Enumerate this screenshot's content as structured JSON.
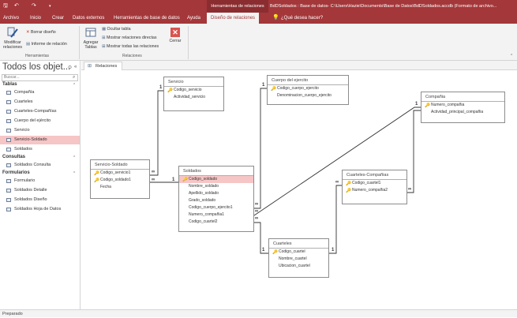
{
  "titlebar": {
    "context_tab": "Herramientas de relaciones",
    "title": "BdDSoldados : Base de datos- C:\\Users\\Hazie\\Documents\\Base de Datos\\BdDSoldados.accdb (Formato de archivo..."
  },
  "tabs": [
    "Archivo",
    "Inicio",
    "Crear",
    "Datos externos",
    "Herramientas de base de datos",
    "Ayuda",
    "Diseño de relaciones",
    "¿Qué desea hacer?"
  ],
  "ribbon": {
    "modify_label": "Modificar relaciones",
    "clear_layout": "Borrar diseño",
    "relation_report": "Informe de relación",
    "tools_group": "Herramientas",
    "add_tables": "Agregar Tablas",
    "hide_table": "Ocultar tabla",
    "direct_relations": "Mostrar relaciones directas",
    "all_relations": "Mostrar todas las relaciones",
    "relations_group": "Relaciones",
    "close": "Cerrar"
  },
  "nav": {
    "header": "Todos los objet...",
    "search_placeholder": "Buscar...",
    "sections": [
      {
        "label": "Tablas",
        "items": [
          "Compañía",
          "Cuarteles",
          "Cuarteles-Compañías",
          "Cuerpo del ejército",
          "Servicio",
          "Servicio-Soldado",
          "Soldados"
        ]
      },
      {
        "label": "Consultas",
        "items": [
          "Soldados Consulta"
        ]
      },
      {
        "label": "Formularios",
        "items": [
          "Formulario",
          "Soldados Detalle",
          "Soldados Diseño",
          "Soldados Hoja de Datos"
        ]
      }
    ],
    "selected": "Servicio-Soldado"
  },
  "doc_tab": "Relaciones",
  "tables": {
    "servicio": {
      "title": "Servicio",
      "fields": [
        "Codigo_servicio",
        "Actividad_servicio"
      ],
      "pk": [
        0
      ]
    },
    "cuerpo": {
      "title": "Cuerpo del ejercito",
      "fields": [
        "Codigo_cuerpo_ejercito",
        "Denominacion_cuerpo_ejercito"
      ],
      "pk": [
        0
      ]
    },
    "compania": {
      "title": "Compañia",
      "fields": [
        "Numero_compañia",
        "Actividad_principal_compañia"
      ],
      "pk": [
        0
      ]
    },
    "servsold": {
      "title": "Servicio-Soldado",
      "fields": [
        "Codigo_servicio1",
        "Codigo_soldado1",
        "Fecha"
      ],
      "pk": [
        0,
        1
      ]
    },
    "soldados": {
      "title": "Soldados",
      "fields": [
        "Codigo_soldado",
        "Nombre_soldado",
        "Apellido_soldado",
        "Grado_soldado",
        "Codigo_cuerpo_ejercito1",
        "Numero_compañia1",
        "Codigo_cuartel2"
      ],
      "pk": [
        0
      ]
    },
    "cuartcomp": {
      "title": "Cuarteles-Compañias",
      "fields": [
        "Codigo_cuartel1",
        "Numero_compañia2"
      ],
      "pk": [
        0,
        1
      ]
    },
    "cuarteles": {
      "title": "Cuarteles",
      "fields": [
        "Codigo_cuartel",
        "Nombre_cuartel",
        "Ubicacion_cuartel"
      ],
      "pk": [
        0
      ]
    }
  },
  "cardinality": {
    "one": "1",
    "many": "∞"
  },
  "status": "Preparado",
  "colors": {
    "accent": "#a4373a",
    "selection": "#f6c5c6"
  }
}
